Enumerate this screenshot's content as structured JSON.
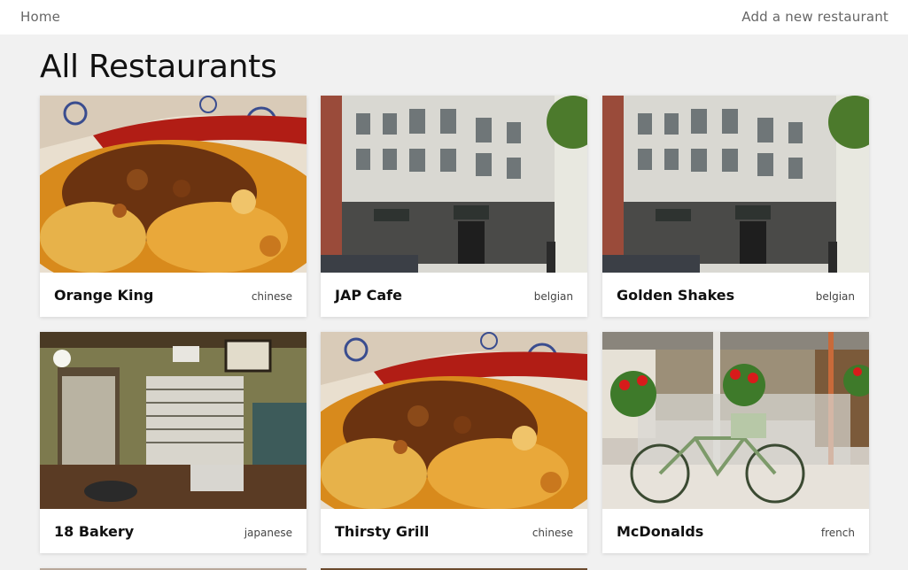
{
  "nav": {
    "home_label": "Home",
    "add_label": "Add a new restaurant"
  },
  "page": {
    "title": "All Restaurants"
  },
  "restaurants": [
    {
      "name": "Orange King",
      "cuisine": "chinese",
      "image": "food-bowl-photo"
    },
    {
      "name": "JAP Cafe",
      "cuisine": "belgian",
      "image": "building-corner-photo"
    },
    {
      "name": "Golden Shakes",
      "cuisine": "belgian",
      "image": "building-corner-photo"
    },
    {
      "name": "18 Bakery",
      "cuisine": "japanese",
      "image": "interior-photo"
    },
    {
      "name": "Thirsty Grill",
      "cuisine": "chinese",
      "image": "food-bowl-photo"
    },
    {
      "name": "McDonalds",
      "cuisine": "french",
      "image": "bicycle-patio-photo"
    }
  ],
  "colors": {
    "background": "#f1f1f1",
    "card": "#ffffff",
    "nav_text": "#666666"
  }
}
